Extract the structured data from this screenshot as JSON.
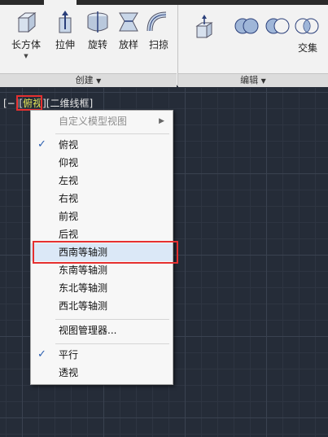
{
  "ribbon": {
    "tools": [
      {
        "label": "长方体",
        "icon": "box-icon"
      },
      {
        "label": "拉伸",
        "icon": "extrude-icon"
      },
      {
        "label": "旋转",
        "icon": "revolve-icon"
      },
      {
        "label": "放样",
        "icon": "loft-icon"
      },
      {
        "label": "扫掠",
        "icon": "sweep-icon"
      }
    ],
    "intersect_label": "交集",
    "panel_create": "创建",
    "panel_edit": "编辑"
  },
  "viewport": {
    "prefix": "[−][",
    "view": "俯视",
    "mid": "][",
    "style": "二维线框",
    "suffix": "]"
  },
  "menu": {
    "custom_views": "自定义模型视图",
    "views": [
      "俯视",
      "仰视",
      "左视",
      "右视",
      "前视",
      "后视",
      "西南等轴测",
      "东南等轴测",
      "东北等轴测",
      "西北等轴测"
    ],
    "view_manager": "视图管理器...",
    "parallel": "平行",
    "perspective": "透视",
    "checkmark": "✓"
  }
}
